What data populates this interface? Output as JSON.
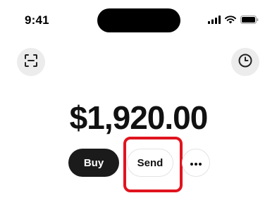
{
  "status_bar": {
    "time": "9:41",
    "icons": [
      "cellular-signal-icon",
      "wifi-icon",
      "battery-icon"
    ]
  },
  "header": {
    "left_button_icon": "scan-icon",
    "right_button_icon": "history-clock-icon"
  },
  "balance": {
    "amount": "$1,920.00"
  },
  "actions": {
    "buy_label": "Buy",
    "send_label": "Send",
    "more_icon": "more-icon"
  },
  "colors": {
    "primary_button": "#1b1b1b",
    "highlight": "#e0141e",
    "icon_button_bg": "#ececec"
  }
}
